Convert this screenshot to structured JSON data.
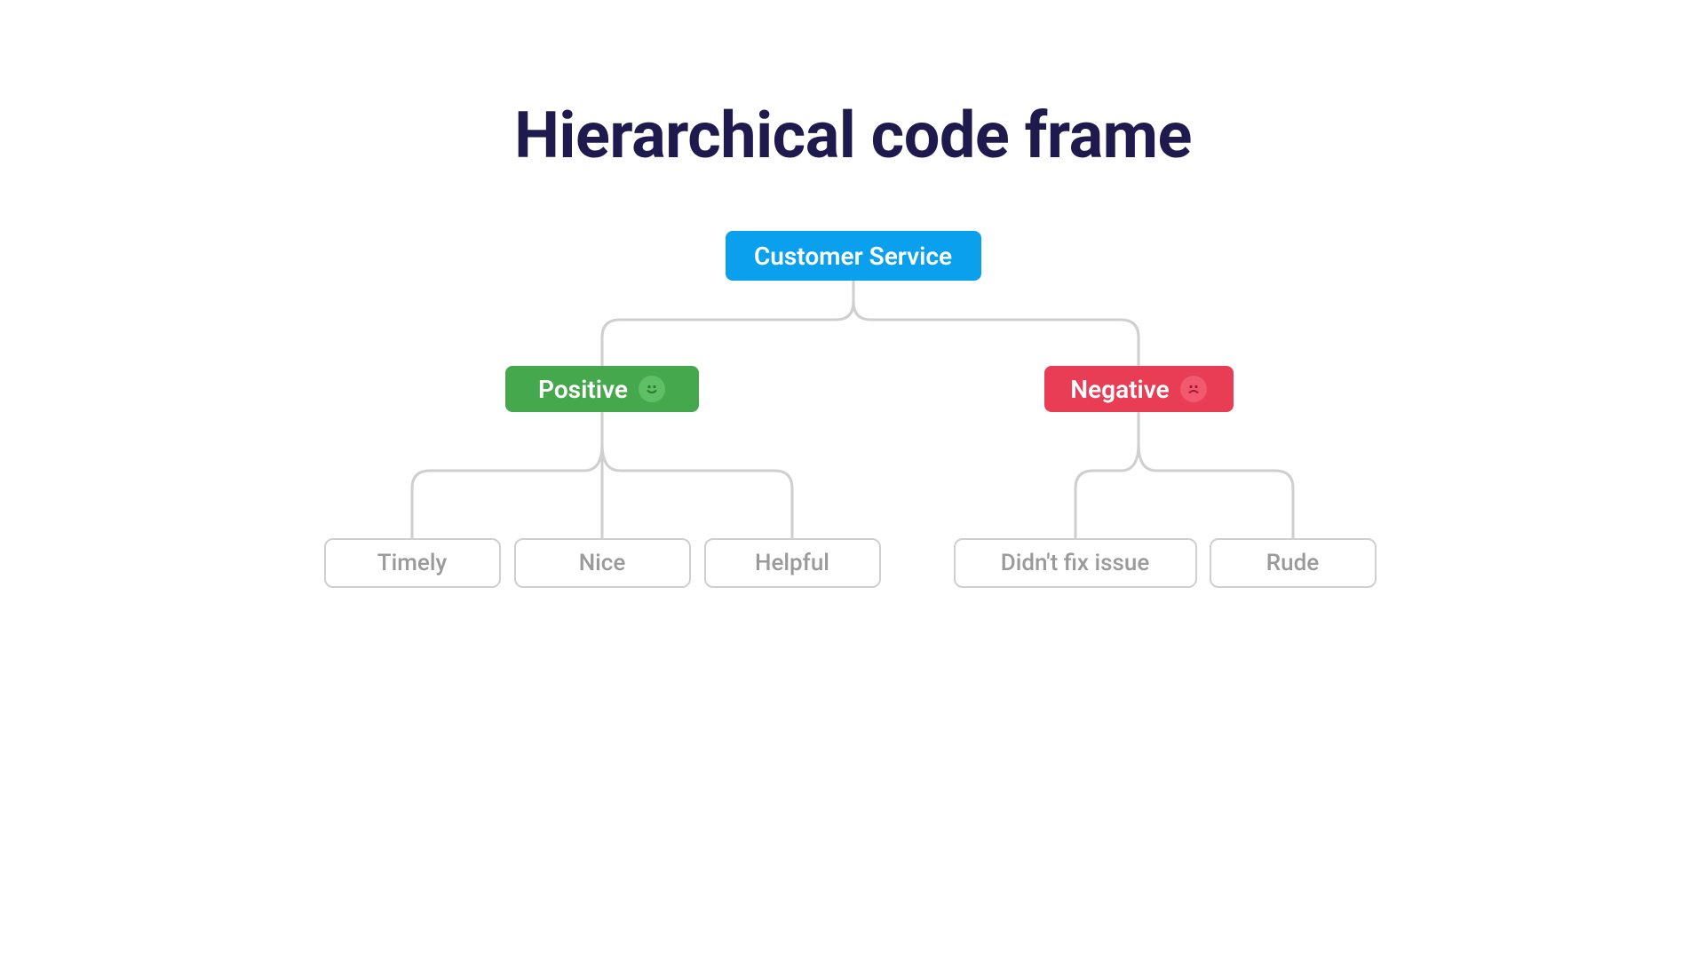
{
  "title": "Hierarchical code frame",
  "root": {
    "label": "Customer Service"
  },
  "positive": {
    "label": "Positive",
    "icon": "smile-icon",
    "children": [
      {
        "label": "Timely"
      },
      {
        "label": "Nice"
      },
      {
        "label": "Helpful"
      }
    ]
  },
  "negative": {
    "label": "Negative",
    "icon": "frown-icon",
    "children": [
      {
        "label": "Didn't fix issue"
      },
      {
        "label": "Rude"
      }
    ]
  },
  "colors": {
    "title": "#1e1a4d",
    "root_bg": "#0aa0ee",
    "positive_bg": "#46a84d",
    "negative_bg": "#e83d55",
    "leaf_border": "#cfcfcf",
    "leaf_text": "#9a9a9a",
    "connector": "#cfcfcf"
  }
}
